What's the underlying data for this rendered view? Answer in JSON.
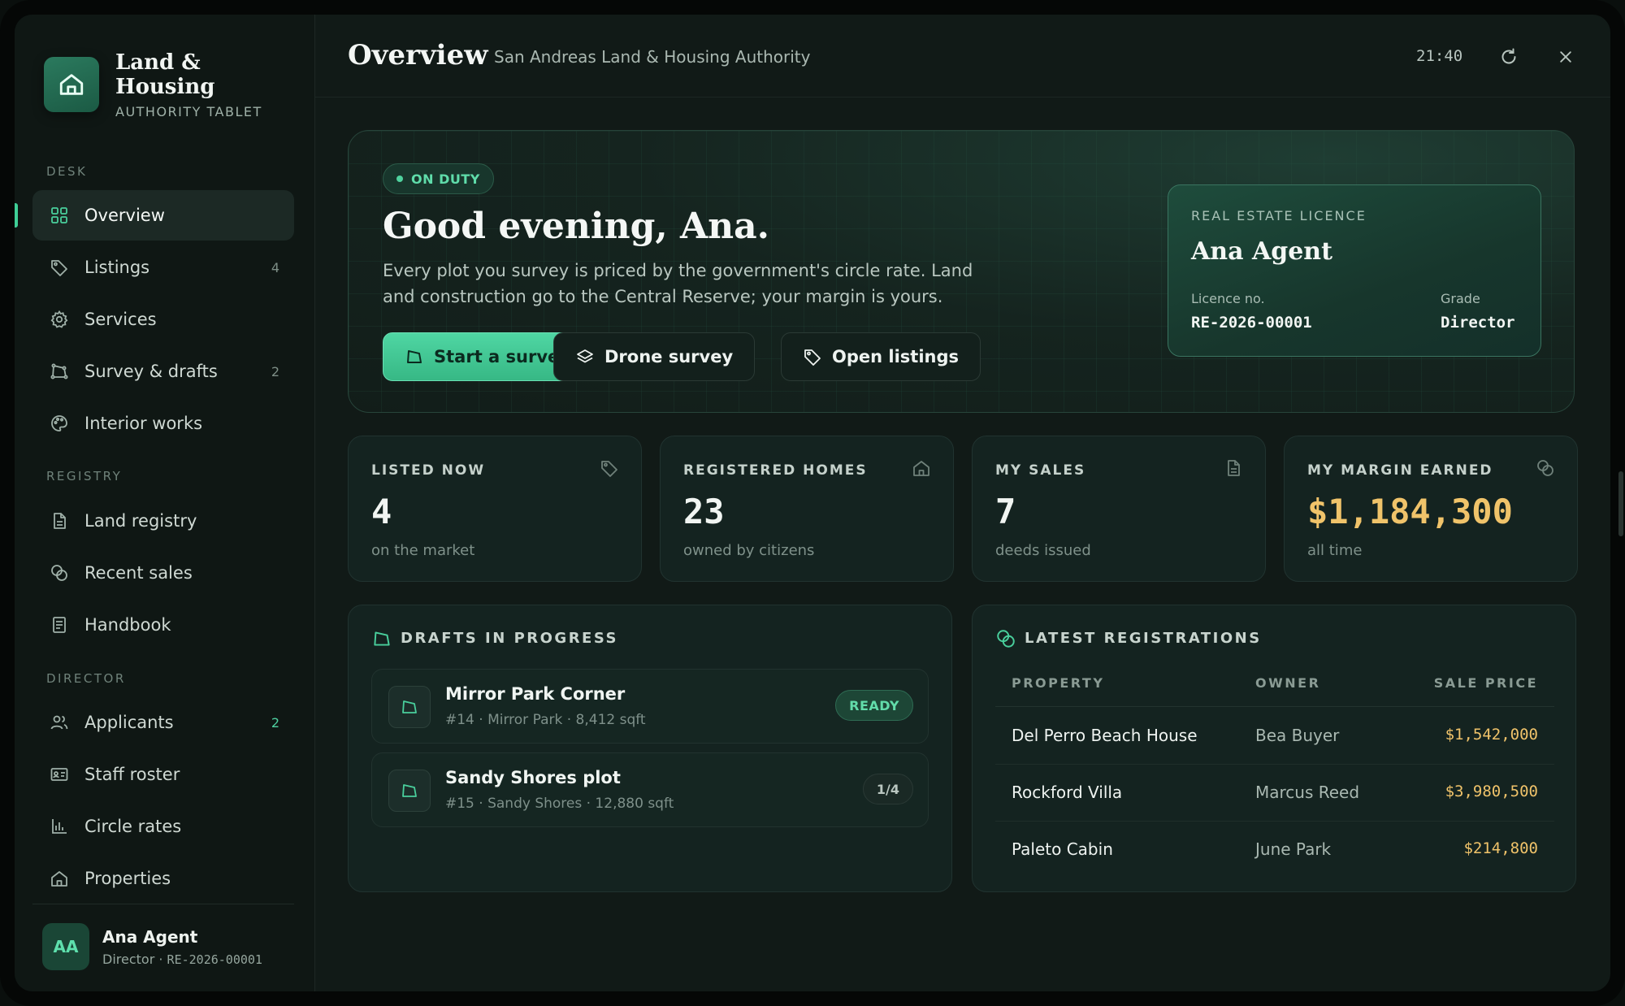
{
  "brand": {
    "title_line1": "Land &",
    "title_line2": "Housing",
    "subtitle": "AUTHORITY TABLET",
    "logo_icon": "house-icon",
    "accent": "#3fcf97"
  },
  "sidebar": {
    "sections": [
      {
        "label": "DESK"
      },
      {
        "label": "REGISTRY"
      },
      {
        "label": "DIRECTOR"
      }
    ],
    "items": [
      {
        "label": "Overview",
        "icon": "grid-icon",
        "count": ""
      },
      {
        "label": "Listings",
        "icon": "tag-icon",
        "count": "4"
      },
      {
        "label": "Services",
        "icon": "gear-icon",
        "count": ""
      },
      {
        "label": "Survey & drafts",
        "icon": "survey-icon",
        "count": "2"
      },
      {
        "label": "Interior works",
        "icon": "palette-icon",
        "count": ""
      },
      {
        "label": "Land registry",
        "icon": "document-icon",
        "count": ""
      },
      {
        "label": "Recent sales",
        "icon": "coins-icon",
        "count": ""
      },
      {
        "label": "Handbook",
        "icon": "book-icon",
        "count": ""
      },
      {
        "label": "Applicants",
        "icon": "users-icon",
        "count": "2"
      },
      {
        "label": "Staff roster",
        "icon": "id-card-icon",
        "count": ""
      },
      {
        "label": "Circle rates",
        "icon": "bar-chart-icon",
        "count": ""
      },
      {
        "label": "Properties",
        "icon": "house-icon",
        "count": ""
      }
    ],
    "active_item": "Overview"
  },
  "user": {
    "initials": "AA",
    "name": "Ana Agent",
    "role": "Director",
    "separator": " · ",
    "licence": "RE-2026-00001"
  },
  "header": {
    "title": "Overview",
    "subtitle": "San Andreas Land & Housing Authority",
    "clock": "21:40"
  },
  "hero": {
    "status": "ON DUTY",
    "greeting": "Good evening, Ana.",
    "text": "Every plot you survey is priced by the government's circle rate. Land and construction go to the Central Reserve; your margin is yours.",
    "buttons": {
      "start_survey": "Start a survey",
      "drone_survey": "Drone survey",
      "open_listings": "Open listings"
    }
  },
  "licence": {
    "label": "REAL ESTATE LICENCE",
    "name": "Ana Agent",
    "licence_no_label": "Licence no.",
    "licence_no": "RE-2026-00001",
    "grade_label": "Grade",
    "grade": "Director"
  },
  "stats": [
    {
      "label": "LISTED NOW",
      "value": "4",
      "note": "on the market",
      "icon": "tag-icon"
    },
    {
      "label": "REGISTERED HOMES",
      "value": "23",
      "note": "owned by citizens",
      "icon": "house-icon"
    },
    {
      "label": "MY SALES",
      "value": "7",
      "note": "deeds issued",
      "icon": "document-icon"
    },
    {
      "label": "MY MARGIN EARNED",
      "value": "$1,184,300",
      "note": "all time",
      "icon": "coins-icon",
      "color": "#f0c36a"
    }
  ],
  "drafts": {
    "title": "DRAFTS IN PROGRESS",
    "items": [
      {
        "name": "Mirror Park Corner",
        "meta": "#14 · Mirror Park · 8,412 sqft",
        "badge": "READY"
      },
      {
        "name": "Sandy Shores plot",
        "meta": "#15 · Sandy Shores · 12,880 sqft",
        "badge": "1/4"
      }
    ]
  },
  "registrations": {
    "title": "LATEST REGISTRATIONS",
    "columns": [
      "PROPERTY",
      "OWNER",
      "SALE PRICE"
    ],
    "rows": [
      {
        "property": "Del Perro Beach House",
        "owner": "Bea Buyer",
        "price": "$1,542,000"
      },
      {
        "property": "Rockford Villa",
        "owner": "Marcus Reed",
        "price": "$3,980,500"
      },
      {
        "property": "Paleto Cabin",
        "owner": "June Park",
        "price": "$214,800"
      }
    ]
  }
}
